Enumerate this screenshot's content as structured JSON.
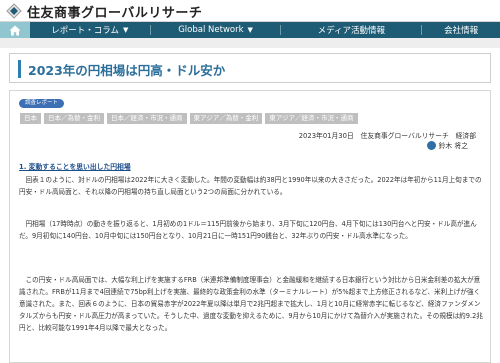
{
  "site": {
    "logo_text": "住友商事グローバルリサーチ",
    "brand_color": "#1e5b74",
    "accent_color": "#8fc6cf"
  },
  "nav": {
    "home_icon": "home-icon",
    "items": [
      {
        "label": "レポート・コラム",
        "has_dropdown": true
      },
      {
        "label": "Global Network",
        "has_dropdown": true
      },
      {
        "label": "メディア活動情報",
        "has_dropdown": false
      },
      {
        "label": "会社情報",
        "has_dropdown": false
      }
    ]
  },
  "page": {
    "title": "2023年の円相場は円高・ドル安か"
  },
  "article": {
    "badge": "調査レポート",
    "tags": [
      "日本",
      "日本／為替・金利",
      "日本／経済・市況・通商",
      "東アジア／為替・金利",
      "東アジア／経済・市況・通商"
    ],
    "meta": "2023年01月30日　住友商事グローバルリサーチ　経済部",
    "author": "鈴木 将之",
    "section_heading": "1. 変動することを思い出した円相場",
    "paragraphs": [
      "　回表１のように、対ドルの円相場は2022年に大きく変動した。年間の変動幅は約38円と1990年以来の大きさだった。2022年は年初から11月上旬までの円安・ドル高局面と、それ以降の円相場の持ち直し局面という2つの局面に分かれている。",
      "　円相場（17時時点）の動きを振り返ると、1月初めの1ドル＝115円前後から始まり、3月下旬に120円台、4月下旬には130円台へと円安・ドル高が進んだ。9月初旬に140円台、10月中旬には150円台となり、10月21日に一時151円90銭台と、32年ぶりの円安・ドル高水準になった。",
      "　この円安・ドル高局面では、大幅な利上げを実施するFRB（米連邦準備制度理事会）と金融緩和を継続する日本銀行という対比から日米金利差の拡大が意識された。FRBが11月まで4回連続で75bp利上げを実施、最終的な政策金利の水準（ターミナルレート）が5%超まで上方修正されるなど、米利上げが強く意識された。また、回表６のように、日本の貿易赤字が2022年夏以降は単月で2兆円超まで拡大し、1月と10月に経常赤字に転じるなど、経済ファンダメンタルズからも円安・ドル高圧力が高まっていた。そうした中、過度な変動を抑えるために、9月から10月にかけて為替介入が実施された。その規模は約9.2兆円と、比較可能な1991年4月以降で最大となった。"
    ]
  }
}
